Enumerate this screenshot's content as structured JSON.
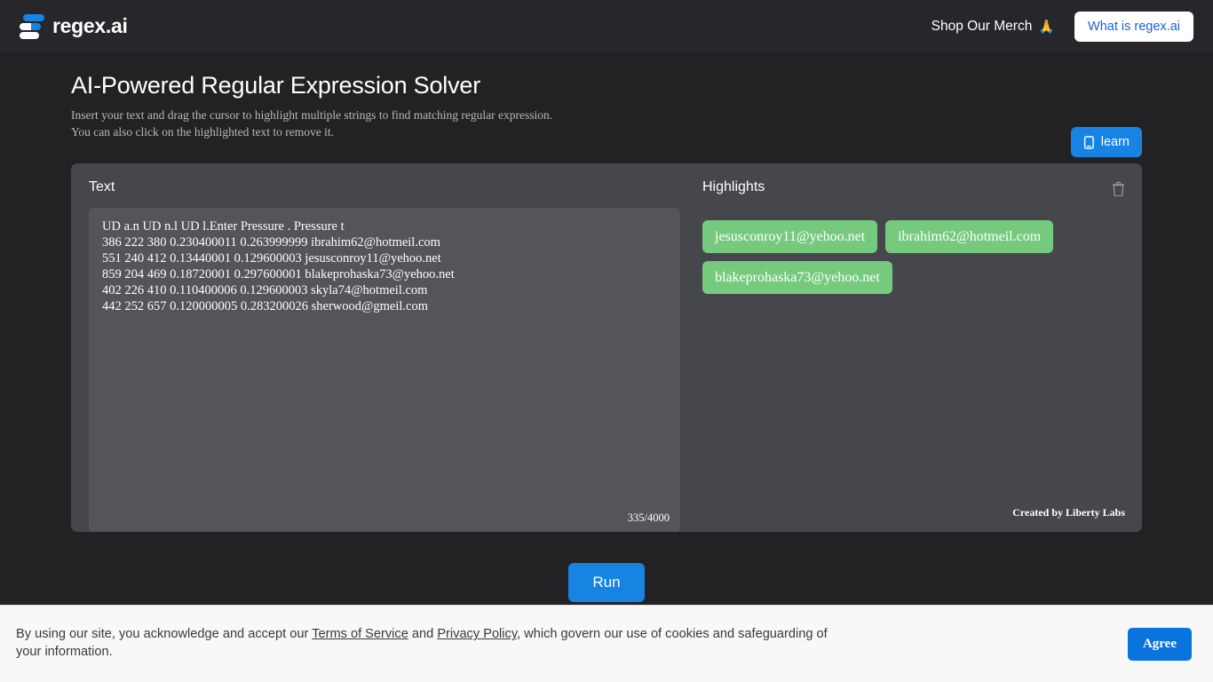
{
  "header": {
    "brand_name": "regex.ai",
    "logo_icon": "stacked-bars-logo",
    "merch_label": "Shop Our Merch",
    "merch_emoji": "🙏",
    "what_is_label": "What is regex.ai",
    "accent_blue": "#1783e3",
    "bar_bg": "#26262b"
  },
  "page": {
    "title": "AI-Powered Regular Expression Solver",
    "subtitle_line1": "Insert your text and drag the cursor to highlight multiple strings to find matching regular expression.",
    "subtitle_line2": "You can also click on the highlighted text to remove it.",
    "learn_label": "learn",
    "learn_icon": "book-icon",
    "background": "#222224"
  },
  "text_pane": {
    "label": "Text",
    "value": "UD a.n UD n.l UD l.Enter Pressure . Pressure t\n386 222 380 0.230400011 0.263999999 ibrahim62@hotmeil.com\n551 240 412 0.13440001 0.129600003 jesusconroy11@yehoo.net\n859 204 469 0.18720001 0.297600001 blakeprohaska73@yehoo.net\n402 226 410 0.110400006 0.129600003 skyla74@hotmeil.com\n442 252 657 0.120000005 0.283200026 sherwood@gmeil.com",
    "char_count": "335/4000",
    "placeholder": ""
  },
  "highlights_pane": {
    "label": "Highlights",
    "clear_icon": "trash-icon",
    "chip_color": "#76ca7e",
    "chips": [
      "jesusconroy11@yehoo.net",
      "ibrahim62@hotmeil.com",
      "blakeprohaska73@yehoo.net"
    ],
    "credit": "Created by Liberty Labs"
  },
  "actions": {
    "run_label": "Run"
  },
  "cookie_banner": {
    "text_part1": "By using our site, you acknowledge and accept our ",
    "terms_label": "Terms of Service",
    "text_part2": " and ",
    "privacy_label": "Privacy Policy",
    "text_part3": ", which govern our use of cookies and safeguarding of your information.",
    "agree_label": "Agree",
    "background": "#f8f8f8"
  }
}
